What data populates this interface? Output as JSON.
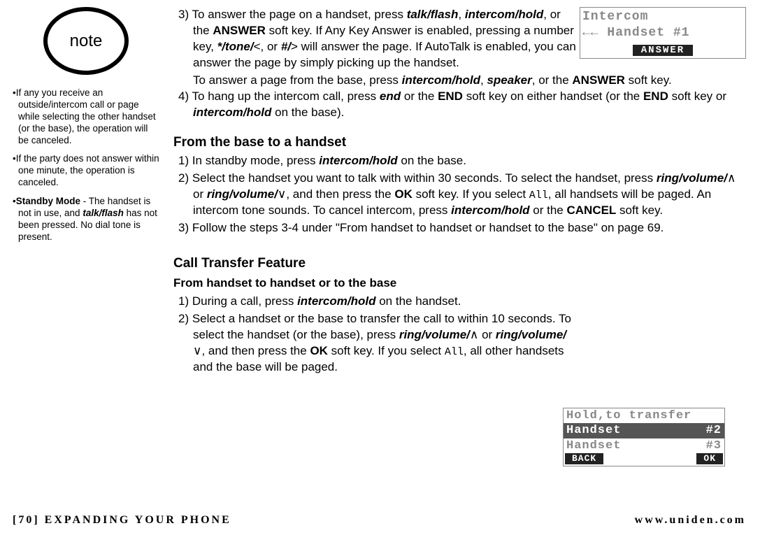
{
  "sidebar": {
    "note_label": "note",
    "items": [
      "If any you receive an outside/intercom call or page while selecting the other handset (or the base), the operation will be canceled.",
      "If the party does not answer within one minute, the operation is canceled.",
      "<span class='b'>Standby Mode</span> - The handset is not in use, and <span class='bi'>talk/flash</span> has not been pressed. No dial tone is present."
    ]
  },
  "screen1": {
    "line1": "Intercom",
    "line2_prefix": "←←",
    "line2": "Handset #1",
    "soft": "ANSWER"
  },
  "screen2": {
    "title": "Hold,to transfer",
    "row1_left": "Handset",
    "row1_right": "#2",
    "row2_left": "Handset",
    "row2_right": "#3",
    "soft_left": "BACK",
    "soft_right": "OK"
  },
  "main": {
    "step3": "3) To answer the page on a handset, press <span class='bi'>talk/flash</span>, <span class='bi'>intercom/hold</span>, or the <span class='b'>ANSWER</span> soft key. If Any Key Answer is enabled, pressing a number key, <span class='bi'>*/tone/</span>&lt;, or <span class='bi'>#/</span>&gt; will answer the page. If AutoTalk is enabled, you can answer the page by simply picking up the handset.",
    "step3b": "To answer a page from the base, press <span class='bi'>intercom/hold</span>, <span class='bi'>speaker</span>, or the <span class='b'>ANSWER</span> soft key.",
    "step4": "4) To hang up the intercom call, press <span class='bi'>end</span> or the <span class='b'>END</span> soft key on either handset (or the <span class='b'>END</span> soft key or <span class='bi'>intercom/hold</span> on the base).",
    "head_base": "From the base to a handset",
    "b1": "1) In standby mode, press <span class='bi'>intercom/hold</span> on the base.",
    "b2": "2) Select the handset you want to talk with within 30 seconds. To select the handset, press <span class='bi'>ring/volume/</span>∧ or <span class='bi'>ring/volume/</span>∨, and then press the <span class='b'>OK</span> soft key. If you select <span class='mono-small'>All</span>, all handsets will be paged. An intercom tone sounds. To cancel intercom, press <span class='bi'>intercom/hold</span> or the <span class='b'>CANCEL</span> soft key.",
    "b3": "3) Follow the steps 3-4 under \"From handset to handset or handset to the base\" on page 69.",
    "head_transfer": "Call Transfer Feature",
    "sub_transfer": "From handset to handset or to the base",
    "t1": "1) During a call, press <span class='bi'>intercom/hold</span> on the handset.",
    "t2": "2) Select a handset or the base to transfer the call to within 10 seconds. To select the handset (or the base), press <span class='bi'>ring/volume/</span>∧ or <span class='bi'>ring/volume/</span>∨, and then press the <span class='b'>OK</span> soft key. If you select <span class='mono-small'>All</span>, all other handsets and the base will be paged."
  },
  "footer": {
    "page_num": "[70]",
    "section": "EXPANDING YOUR PHONE",
    "url": "www.uniden.com"
  }
}
